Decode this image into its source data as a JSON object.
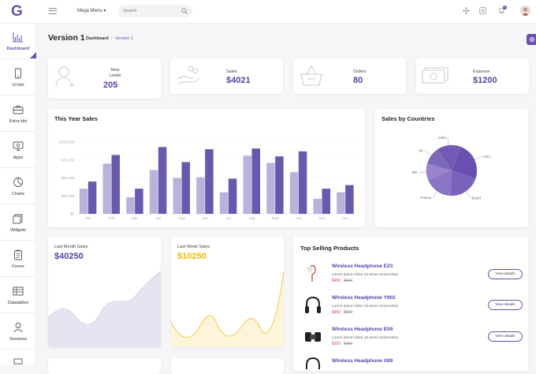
{
  "header": {
    "logo": "G",
    "mega_menu": "Mega Menu",
    "search_placeholder": "Search",
    "notification_count": "2"
  },
  "sidebar": {
    "items": [
      {
        "label": "Dashboard",
        "icon": "bar-chart-icon",
        "active": true
      },
      {
        "label": "UI kits",
        "icon": "mobile-icon"
      },
      {
        "label": "Extra kits",
        "icon": "briefcase-icon"
      },
      {
        "label": "Apps",
        "icon": "monitor-icon"
      },
      {
        "label": "Charts",
        "icon": "pie-chart-icon"
      },
      {
        "label": "Widgets",
        "icon": "layers-icon"
      },
      {
        "label": "Forms",
        "icon": "clipboard-icon"
      },
      {
        "label": "Datatables",
        "icon": "table-icon"
      },
      {
        "label": "Sessions",
        "icon": "user-icon"
      }
    ]
  },
  "page": {
    "title": "Version 1",
    "breadcrumb": [
      "Dashboard",
      "|",
      "Version 1"
    ]
  },
  "stats": [
    {
      "label": "New Leads",
      "value": "205",
      "icon": "user-add-icon"
    },
    {
      "label": "Sales",
      "value": "$4021",
      "icon": "money-hand-icon"
    },
    {
      "label": "Orders",
      "value": "80",
      "icon": "basket-icon"
    },
    {
      "label": "Expense",
      "value": "$1200",
      "icon": "cash-icon"
    }
  ],
  "colors": {
    "accent": "#6a4fb0",
    "bar_light": "#b9b3dc",
    "bar_dark": "#6a57b0",
    "sales_orange": "#f5b700",
    "price_red": "#e04646"
  },
  "chart_data": [
    {
      "type": "bar",
      "title": "This Year Sales",
      "categories": [
        "Jan",
        "Feb",
        "Mar",
        "Apr",
        "May",
        "Jun",
        "Jul",
        "Aug",
        "Sept",
        "Oct",
        "Nov",
        "Dec"
      ],
      "y_ticks": [
        "$100,000",
        "$75,000",
        "$50,000",
        "$25,000",
        "$0"
      ],
      "ylim": [
        0,
        100000
      ],
      "series": [
        {
          "values": [
            35000,
            70000,
            23000,
            61000,
            50000,
            51000,
            30000,
            81000,
            71000,
            58000,
            21000,
            30000
          ]
        },
        {
          "values": [
            45000,
            82000,
            35000,
            93000,
            72000,
            90000,
            49000,
            91000,
            80000,
            87000,
            35000,
            40000
          ]
        }
      ]
    },
    {
      "type": "pie",
      "title": "Sales by Countries",
      "labels": [
        "USA",
        "Brazil",
        "France",
        "BD",
        "UK",
        "India"
      ],
      "values": [
        25,
        20,
        18,
        11,
        11,
        15
      ]
    }
  ],
  "last_month": {
    "label": "Last Month Sales",
    "value": "$40250"
  },
  "last_week": {
    "label": "Last Week Sales",
    "value": "$10250"
  },
  "top_selling": {
    "title": "Top Selling Products",
    "button_label": "View details",
    "items": [
      {
        "name": "Wireless Headphone E23",
        "desc": "Lorem ipsum dolor sit amet consectetur.",
        "price": "$450",
        "old_price": "$500",
        "icon": "earphone-icon"
      },
      {
        "name": "Wireless Headphone Y902",
        "desc": "Lorem ipsum dolor sit amet consectetur.",
        "price": "$450",
        "old_price": "$500",
        "icon": "headphone-icon"
      },
      {
        "name": "Wireless Headphone E09",
        "desc": "Lorem ipsum dolor sit amet consectetur.",
        "price": "$250",
        "old_price": "$250",
        "icon": "speaker-icon"
      },
      {
        "name": "Wireless Headphone X89",
        "desc": "",
        "price": "",
        "old_price": "",
        "icon": "headphone-icon"
      }
    ]
  }
}
